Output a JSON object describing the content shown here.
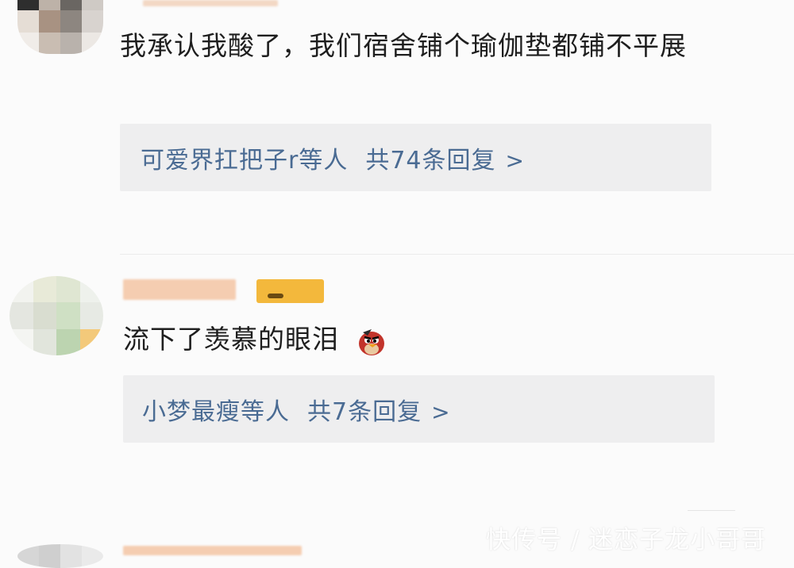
{
  "comments": [
    {
      "text": "我承认我酸了，我们宿舍铺个瑜伽垫都铺不平展",
      "reply_users": "可爱界扛把子r等人",
      "reply_count": "共74条回复",
      "reply_arrow": ">"
    },
    {
      "text": "流下了羡慕的眼泪",
      "emoji": "angry-bird-emoji",
      "reply_users": "小梦最瘦等人",
      "reply_count": "共7条回复",
      "reply_arrow": ">"
    }
  ],
  "watermark": "快传号 / 迷恋子龙小哥哥",
  "colors": {
    "link": "#4a6b93",
    "reply_bg": "#eeeeef",
    "page_bg": "#fbfbfb",
    "badge": "#f2b53a"
  }
}
